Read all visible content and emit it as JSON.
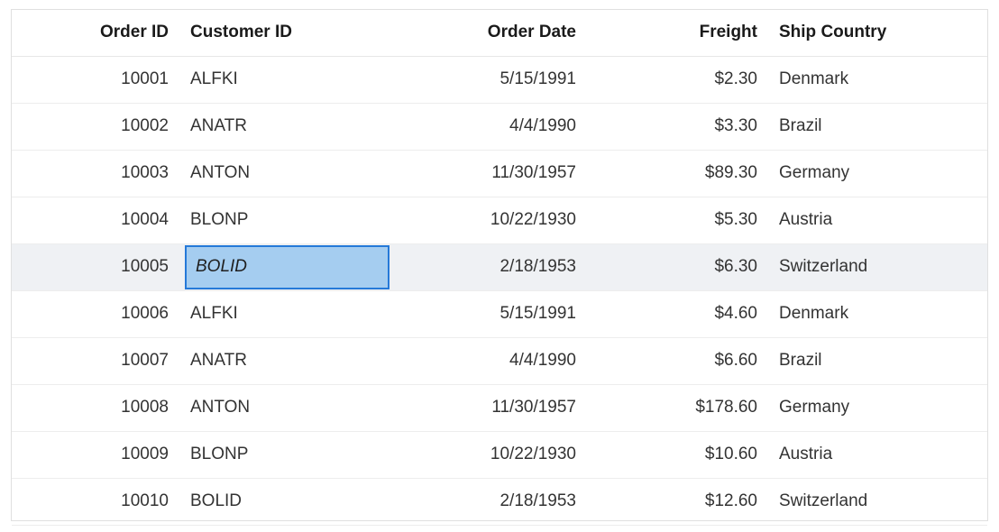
{
  "grid": {
    "columns": [
      {
        "key": "order_id",
        "label": "Order ID",
        "align": "right"
      },
      {
        "key": "customer_id",
        "label": "Customer ID",
        "align": "left"
      },
      {
        "key": "order_date",
        "label": "Order Date",
        "align": "right"
      },
      {
        "key": "freight",
        "label": "Freight",
        "align": "right"
      },
      {
        "key": "ship_country",
        "label": "Ship Country",
        "align": "left"
      }
    ],
    "header": {
      "order_id": "Order ID",
      "customer_id": "Customer ID",
      "order_date": "Order Date",
      "freight": "Freight",
      "ship_country": "Ship Country"
    },
    "selected_row_index": 4,
    "editing_cell": {
      "row_index": 4,
      "column": "customer_id",
      "value": "BOLID"
    },
    "colors": {
      "edit_cell_fill": "#a5cdf0",
      "edit_cell_border": "#2579d8",
      "selected_row_background": "#eff1f4",
      "grid_border": "#e0e0e0",
      "row_separator": "#ededed",
      "header_text": "#1a1a1a",
      "cell_text": "#333333"
    },
    "rows": [
      {
        "order_id": "10001",
        "customer_id": "ALFKI",
        "order_date": "5/15/1991",
        "freight": "$2.30",
        "ship_country": "Denmark"
      },
      {
        "order_id": "10002",
        "customer_id": "ANATR",
        "order_date": "4/4/1990",
        "freight": "$3.30",
        "ship_country": "Brazil"
      },
      {
        "order_id": "10003",
        "customer_id": "ANTON",
        "order_date": "11/30/1957",
        "freight": "$89.30",
        "ship_country": "Germany"
      },
      {
        "order_id": "10004",
        "customer_id": "BLONP",
        "order_date": "10/22/1930",
        "freight": "$5.30",
        "ship_country": "Austria"
      },
      {
        "order_id": "10005",
        "customer_id": "BOLID",
        "order_date": "2/18/1953",
        "freight": "$6.30",
        "ship_country": "Switzerland"
      },
      {
        "order_id": "10006",
        "customer_id": "ALFKI",
        "order_date": "5/15/1991",
        "freight": "$4.60",
        "ship_country": "Denmark"
      },
      {
        "order_id": "10007",
        "customer_id": "ANATR",
        "order_date": "4/4/1990",
        "freight": "$6.60",
        "ship_country": "Brazil"
      },
      {
        "order_id": "10008",
        "customer_id": "ANTON",
        "order_date": "11/30/1957",
        "freight": "$178.60",
        "ship_country": "Germany"
      },
      {
        "order_id": "10009",
        "customer_id": "BLONP",
        "order_date": "10/22/1930",
        "freight": "$10.60",
        "ship_country": "Austria"
      },
      {
        "order_id": "10010",
        "customer_id": "BOLID",
        "order_date": "2/18/1953",
        "freight": "$12.60",
        "ship_country": "Switzerland"
      }
    ]
  }
}
